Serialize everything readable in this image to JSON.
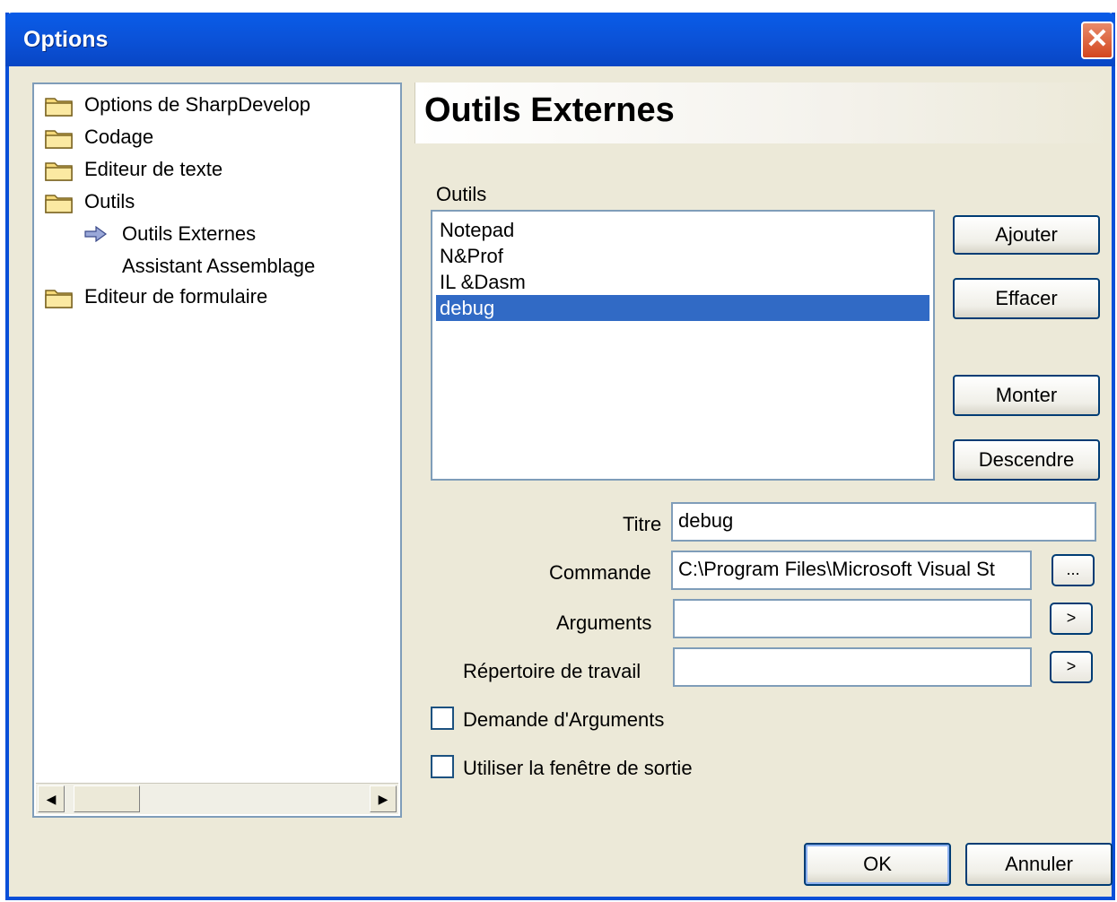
{
  "window": {
    "title": "Options",
    "close_glyph": "✕"
  },
  "tree": {
    "items": [
      {
        "label": "Options de SharpDevelop",
        "icon": "folder-icon"
      },
      {
        "label": "Codage",
        "icon": "folder-icon"
      },
      {
        "label": "Editeur de texte",
        "icon": "folder-icon"
      },
      {
        "label": "Outils",
        "icon": "folder-open-icon"
      },
      {
        "label": "Outils Externes",
        "icon": "arrow-right-icon"
      },
      {
        "label": "Assistant Assemblage",
        "icon": ""
      },
      {
        "label": "Editeur de formulaire",
        "icon": "folder-icon"
      }
    ],
    "scroll_left_glyph": "◀",
    "scroll_right_glyph": "▶"
  },
  "panel": {
    "title": "Outils Externes",
    "tools_label": "Outils",
    "tools": [
      "Notepad",
      "N&Prof",
      "IL &Dasm",
      "debug"
    ],
    "selected_tool": "debug",
    "buttons": {
      "add": "Ajouter",
      "delete": "Effacer",
      "up": "Monter",
      "down": "Descendre"
    },
    "fields": {
      "title_label": "Titre",
      "title_value": "debug",
      "command_label": "Commande",
      "command_value": "C:\\Program Files\\Microsoft Visual St",
      "command_browse": "...",
      "arguments_label": "Arguments",
      "arguments_value": "",
      "arguments_btn": ">",
      "workdir_label": "Répertoire de travail",
      "workdir_value": "",
      "workdir_btn": ">"
    },
    "checkboxes": {
      "prompt_args": "Demande d'Arguments",
      "use_output": "Utiliser la fenêtre de sortie"
    }
  },
  "footer": {
    "ok": "OK",
    "cancel": "Annuler"
  },
  "colors": {
    "titlebar": "#0a5ce8",
    "selection": "#316ac5",
    "face": "#ece9d8"
  }
}
